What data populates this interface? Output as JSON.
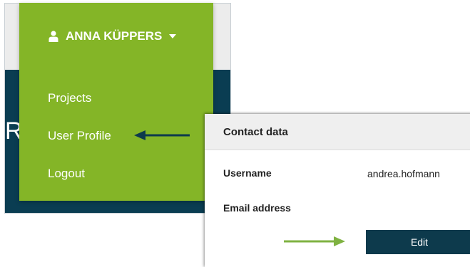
{
  "background": {
    "partial_text": "Re"
  },
  "menu": {
    "user_name": "ANNA KÜPPERS",
    "items": [
      {
        "label": "Projects"
      },
      {
        "label": "User Profile"
      },
      {
        "label": "Logout"
      }
    ]
  },
  "contact": {
    "title": "Contact data",
    "username_label": "Username",
    "username_value": "andrea.hofmann",
    "email_label": "Email address",
    "edit_label": "Edit"
  },
  "colors": {
    "menu_green": "#84b527",
    "dark_teal": "#0a3d52",
    "arrow_dark": "#0d3a4c",
    "arrow_green": "#7fb241"
  },
  "icons": {
    "user": "user-icon",
    "caret": "chevron-down-icon",
    "pointer_dark": "arrow-left-icon",
    "pointer_green": "arrow-right-icon"
  }
}
